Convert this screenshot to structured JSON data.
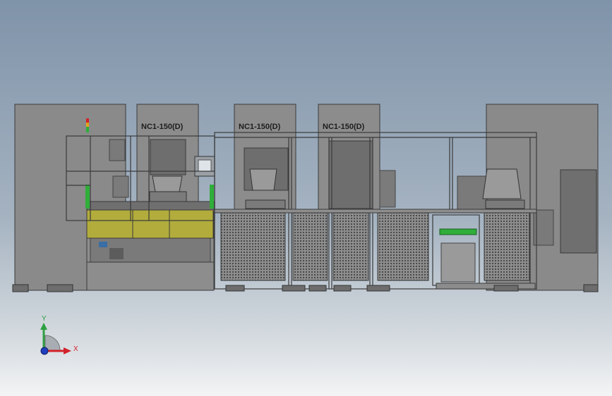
{
  "scene": {
    "press_labels": [
      "NC1-150(D)",
      "NC1-150(D)",
      "NC1-150(D)"
    ],
    "triad": {
      "x_label": "X",
      "y_label": "Y",
      "x_color": "#d2232a",
      "y_color": "#2ea043",
      "z_color": "#1f3fbf"
    },
    "colors": {
      "body_gray": "#8c8c8c",
      "panel_dark": "#707070",
      "frame_line": "#3a3a3a",
      "mesh_dark": "#4a4a4a",
      "conveyor_olive": "#b2ac3c",
      "indicator_green": "#2fae3a"
    }
  }
}
